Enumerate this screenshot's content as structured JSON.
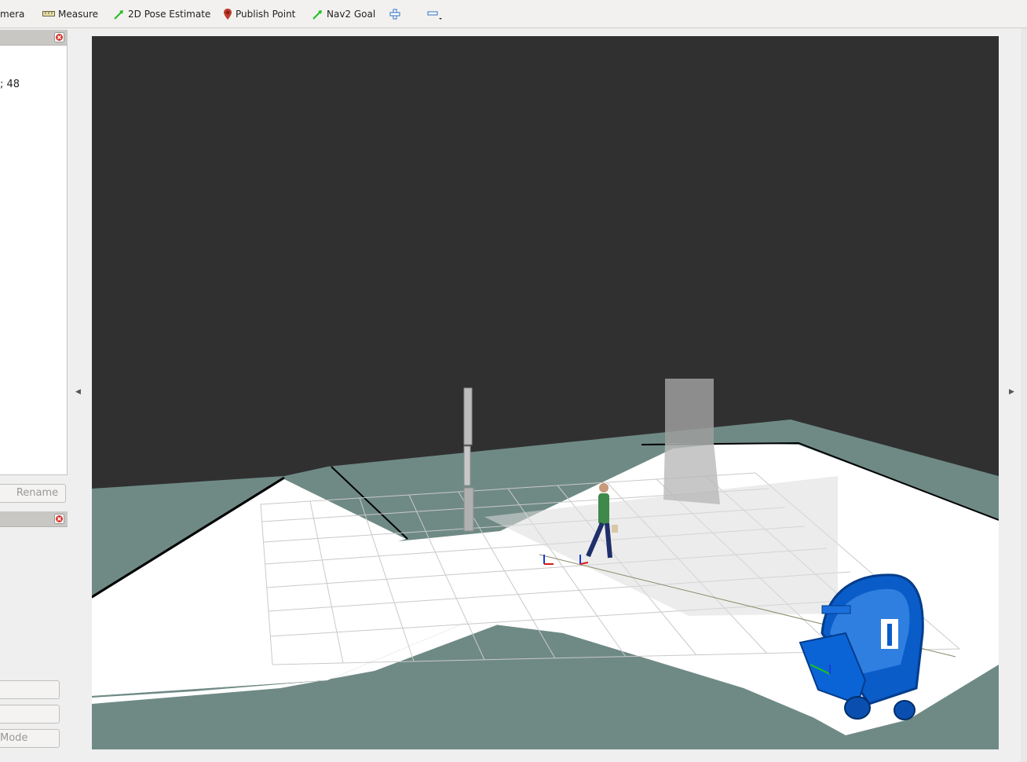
{
  "toolbar": {
    "tools": [
      {
        "label": "mera",
        "icon": "camera-icon"
      },
      {
        "label": "Measure",
        "icon": "ruler-icon"
      },
      {
        "label": "2D Pose Estimate",
        "icon": "green-arrow-icon"
      },
      {
        "label": "Publish Point",
        "icon": "map-pin-icon"
      },
      {
        "label": "Nav2 Goal",
        "icon": "green-arrow-icon"
      }
    ],
    "add_icon": "plus-icon",
    "remove_icon": "minus-icon"
  },
  "left_panel": {
    "top_text": "; 48",
    "rename_button": "Rename",
    "mode_button": "Mode"
  },
  "viewport": {
    "background": "#303030",
    "floor_color": "#ffffff",
    "unknown_map_color": "#6f8a85",
    "robot_color": "#0055c8"
  }
}
